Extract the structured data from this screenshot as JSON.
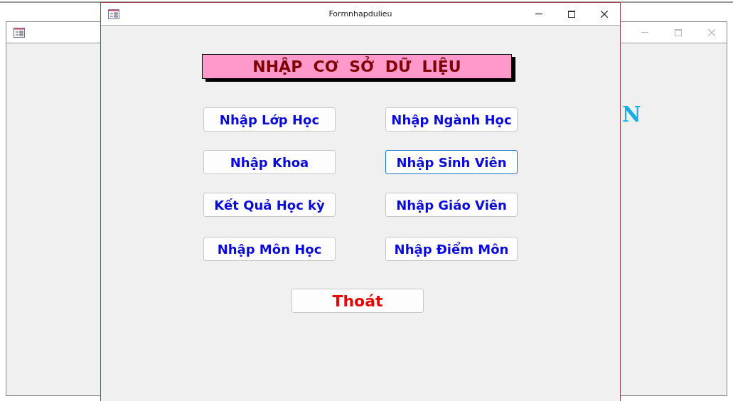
{
  "background_window": {
    "heading_visible": "N"
  },
  "window": {
    "title": "Formnhapdulieu"
  },
  "heading": "NHẬP  CƠ  SỞ  DỮ  LIỆU",
  "buttons": [
    {
      "label": "Nhập Lớp Học",
      "focused": false
    },
    {
      "label": "Nhập Ngành Học",
      "focused": false
    },
    {
      "label": "Nhập Khoa",
      "focused": false
    },
    {
      "label": "Nhập Sinh Viên",
      "focused": true
    },
    {
      "label": "Kết Quả Học kỳ",
      "focused": false
    },
    {
      "label": "Nhập Giáo Viên",
      "focused": false
    },
    {
      "label": "Nhập Môn Học",
      "focused": false
    },
    {
      "label": "Nhập Điểm Môn",
      "focused": false
    }
  ],
  "exit_button": "Thoát"
}
